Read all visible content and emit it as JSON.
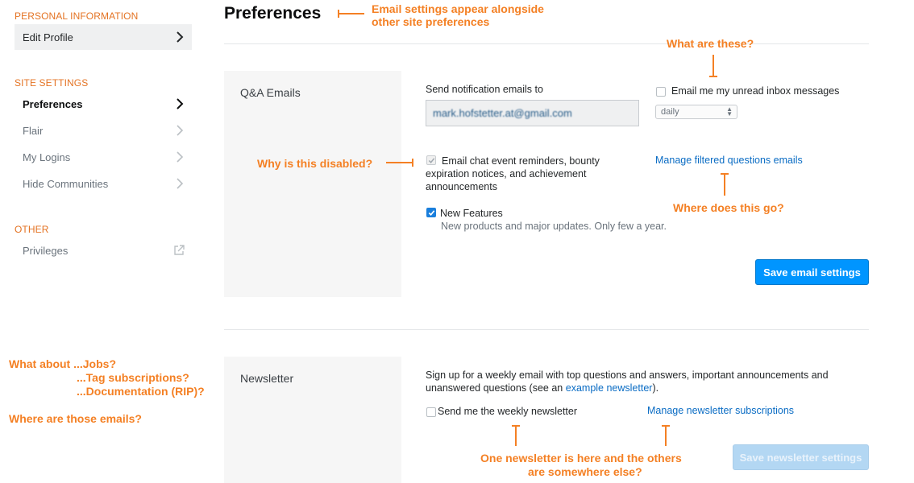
{
  "sidebar": {
    "personal_heading": "PERSONAL INFORMATION",
    "edit_profile": "Edit Profile",
    "site_heading": "SITE SETTINGS",
    "site_items": [
      "Preferences",
      "Flair",
      "My Logins",
      "Hide Communities"
    ],
    "other_heading": "OTHER",
    "privileges": "Privileges"
  },
  "page": {
    "title": "Preferences"
  },
  "qa_emails": {
    "title": "Q&A Emails",
    "send_label": "Send notification emails to",
    "email_value": "mark.hofstetter.at@gmail.com",
    "inbox_label": "Email me my unread inbox messages",
    "frequency": "daily",
    "chat_label": "Email chat event reminders, bounty expiration notices, and achievement announcements",
    "manage_filtered": "Manage filtered questions emails",
    "new_features_label": "New Features",
    "new_features_desc": "New products and major updates. Only few a year.",
    "save_button": "Save email settings"
  },
  "newsletter": {
    "title": "Newsletter",
    "desc_prefix": "Sign up for a weekly email with top questions and answers, important announcements and unanswered questions (see an",
    "example_link": "example newsletter",
    "desc_suffix": ").",
    "weekly_label": "Send me the weekly newsletter",
    "manage_subscriptions": "Manage newsletter subscriptions",
    "save_button": "Save newsletter settings"
  },
  "annotations": {
    "alongside_1": "Email settings appear alongside",
    "alongside_2": "other site preferences",
    "what_are_these": "What are these?",
    "why_disabled": "Why is this disabled?",
    "where_go": "Where does this go?",
    "jobs": "What about ...Jobs?",
    "tags": "...Tag subscriptions?",
    "docs": "...Documentation (RIP)?",
    "where_emails": "Where are those emails?",
    "newsletter_1": "One newsletter is here and the others",
    "newsletter_2": "are somewhere else?"
  },
  "colors": {
    "accent": "#f48024",
    "primary": "#0095ff",
    "link": "#0a6cc4"
  }
}
